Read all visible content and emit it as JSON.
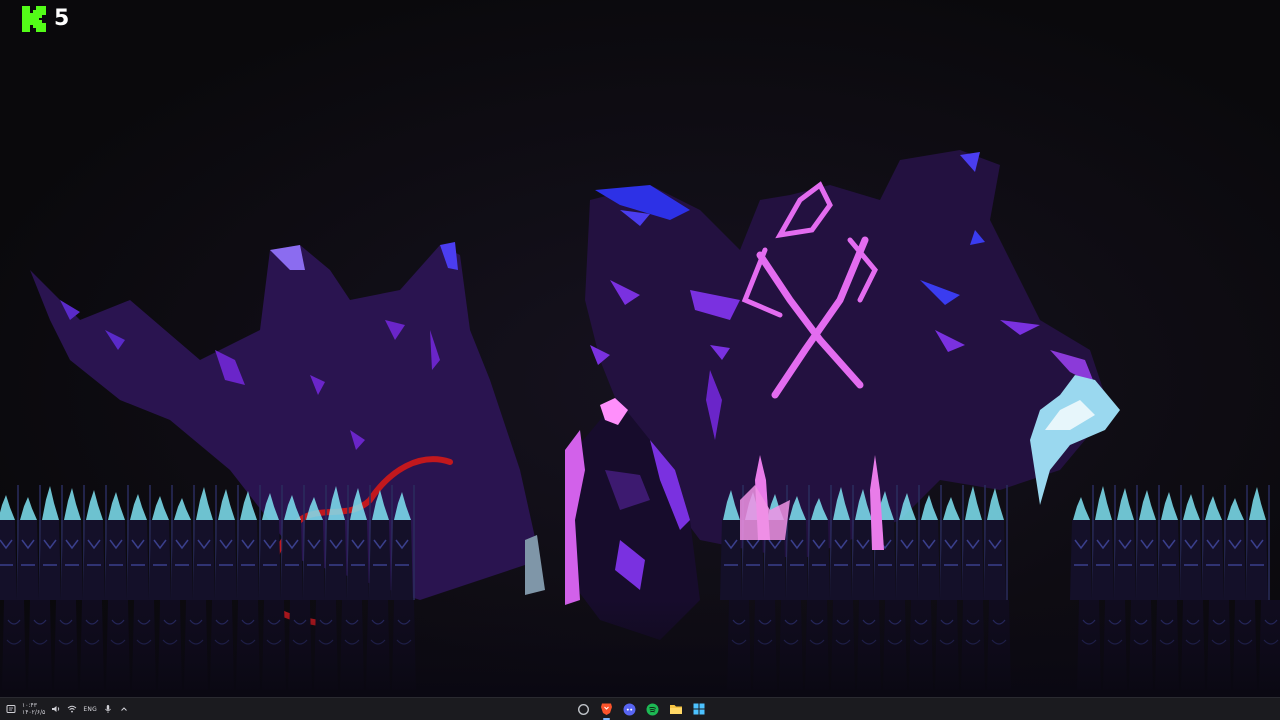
{
  "overlay": {
    "brand_icon": "kick-logo-icon",
    "brand_color": "#53fc18",
    "count": "5"
  },
  "scene": {
    "palette": {
      "sky": "#0c0b0f",
      "shadow": "#2a1350",
      "violet": "#6a25c9",
      "magenta": "#e36cf0",
      "cyan_flame": "#7fe3f2",
      "blood": "#c2181d",
      "cloak": "#7f96a8"
    }
  },
  "taskbar": {
    "tray_left": {
      "icons": [
        "notification-icon",
        "volume-icon",
        "wifi-icon",
        "microphone-icon",
        "chevron-up-icon"
      ],
      "clock_time": "۱۰:۴۳",
      "clock_date": "۱۴۰۲/۶/۵",
      "language": "ENG"
    },
    "apps": [
      {
        "name": "cortana-icon",
        "color": "#bfc3c8"
      },
      {
        "name": "brave-browser-icon",
        "color": "#fb542b",
        "active": true
      },
      {
        "name": "discord-icon",
        "color": "#5865f2"
      },
      {
        "name": "spotify-icon",
        "color": "#1db954"
      },
      {
        "name": "file-explorer-icon",
        "color": "#f5c342"
      },
      {
        "name": "windows-start-icon",
        "color": "#4cc2ff"
      }
    ]
  }
}
